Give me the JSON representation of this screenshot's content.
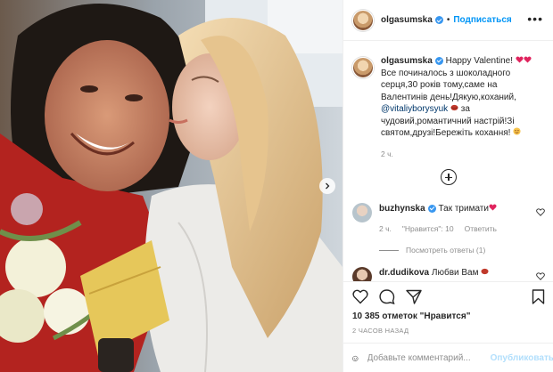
{
  "post": {
    "username": "olgasumska",
    "follow_label": "Подписаться",
    "separator": "•",
    "more_label": "•••"
  },
  "caption": {
    "username": "olgasumska",
    "text_before": " Happy Valentine!",
    "text_main": "Все починалось з шоколадного серця,30 років тому,саме на Валентинів день!Дякую,коханий,",
    "mention": "@vitaliyborysyuk",
    "text_after": "за чудовий,романтичний настрій!Зі святом,друзі!Бережіть кохання!",
    "time": "2 ч."
  },
  "comments": [
    {
      "username": "buzhynska",
      "text": "Так тримати",
      "time": "2 ч.",
      "likes_label": "\"Нравится\": 10",
      "reply_label": "Ответить",
      "view_replies": "Посмотреть ответы (1)"
    },
    {
      "username": "dr.dudikova",
      "text": "Любви Вам"
    }
  ],
  "footer": {
    "likes": "10 385 отметок \"Нравится\"",
    "posted": "2 ЧАСОВ НАЗАД",
    "comment_placeholder": "Добавьте комментарий...",
    "publish_label": "Опубликовать"
  },
  "icons": {
    "heart": "heart-icon",
    "comment": "comment-icon",
    "share": "share-icon",
    "bookmark": "bookmark-icon",
    "emoji": "emoji-icon"
  },
  "colors": {
    "link_blue": "#0095f6",
    "muted": "#8e8e8e",
    "text": "#262626",
    "heart_red": "#e0245e",
    "publish_disabled": "#b2dffc"
  }
}
